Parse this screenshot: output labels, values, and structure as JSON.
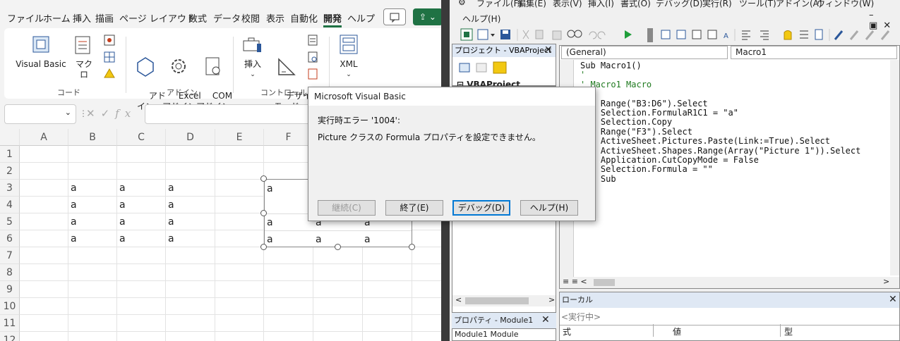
{
  "excel": {
    "menu_tabs": [
      "ファイル",
      "ホーム",
      "挿入",
      "描画",
      "ページ レイアウト",
      "数式",
      "データ",
      "校閲",
      "表示",
      "自動化",
      "開発",
      "ヘルプ"
    ],
    "active_tab": "開発",
    "ribbon": {
      "code_group": {
        "label": "コード",
        "visual_basic": "Visual Basic",
        "macro": "マクロ"
      },
      "addin_group": {
        "label": "アドイン",
        "addin": "アド\nイン",
        "excel_addin": "Excel\nアドイン",
        "com_addin": "COM\nアドイン"
      },
      "control_group": {
        "label": "コントロール",
        "insert": "挿入",
        "design_mode": "デザイン\nモード"
      },
      "xml": "XML"
    },
    "formula_bar": {
      "fx": "fx"
    },
    "columns": [
      "A",
      "B",
      "C",
      "D",
      "E",
      "F"
    ],
    "rows": [
      "1",
      "2",
      "3",
      "4",
      "5",
      "6",
      "7",
      "8",
      "9",
      "10",
      "11",
      "12"
    ],
    "cells": {
      "B3": "a",
      "C3": "a",
      "D3": "a",
      "B4": "a",
      "C4": "a",
      "D4": "a",
      "B5": "a",
      "C5": "a",
      "D5": "a",
      "B6": "a",
      "C6": "a",
      "D6": "a"
    },
    "picture_cells": [
      [
        "a",
        "",
        ""
      ],
      [
        "",
        "",
        ""
      ],
      [
        "a",
        "a",
        "a"
      ],
      [
        "a",
        "a",
        "a"
      ]
    ]
  },
  "vbe": {
    "menu": [
      "ファイル(F)",
      "編集(E)",
      "表示(V)",
      "挿入(I)",
      "書式(O)",
      "デバッグ(D)",
      "実行(R)",
      "ツール(T)",
      "アドイン(A)",
      "ウィンドウ(W)"
    ],
    "help_menu": "ヘルプ(H)",
    "project_title": "プロジェクト - VBAProject",
    "project_node": "VBAProject (Book1",
    "properties_title": "プロパティ - Module1",
    "properties_combo": "Module1 Module",
    "combo_general": "(General)",
    "combo_proc": "Macro1",
    "code_lines": [
      "Sub Macro1()",
      "'",
      "' Macro1 Macro",
      "'",
      "",
      "    Range(\"B3:D6\").Select",
      "    Selection.FormulaR1C1 = \"a\"",
      "    Selection.Copy",
      "    Range(\"F3\").Select",
      "    ActiveSheet.Pictures.Paste(Link:=True).Select",
      "    ActiveSheet.Shapes.Range(Array(\"Picture 1\")).Select",
      "    Application.CutCopyMode = False",
      "    Selection.Formula = \"\"",
      "    Sub"
    ],
    "locals_title": "ローカル",
    "locals_status": "<実行中>",
    "locals_cols": [
      "式",
      "値",
      "型"
    ]
  },
  "dialog": {
    "title": "Microsoft Visual Basic",
    "error_line": "実行時エラー '1004':",
    "message": "Picture クラスの Formula プロパティを設定できません。",
    "buttons": {
      "continue": "継続(C)",
      "end": "終了(E)",
      "debug": "デバッグ(D)",
      "help": "ヘルプ(H)"
    }
  }
}
